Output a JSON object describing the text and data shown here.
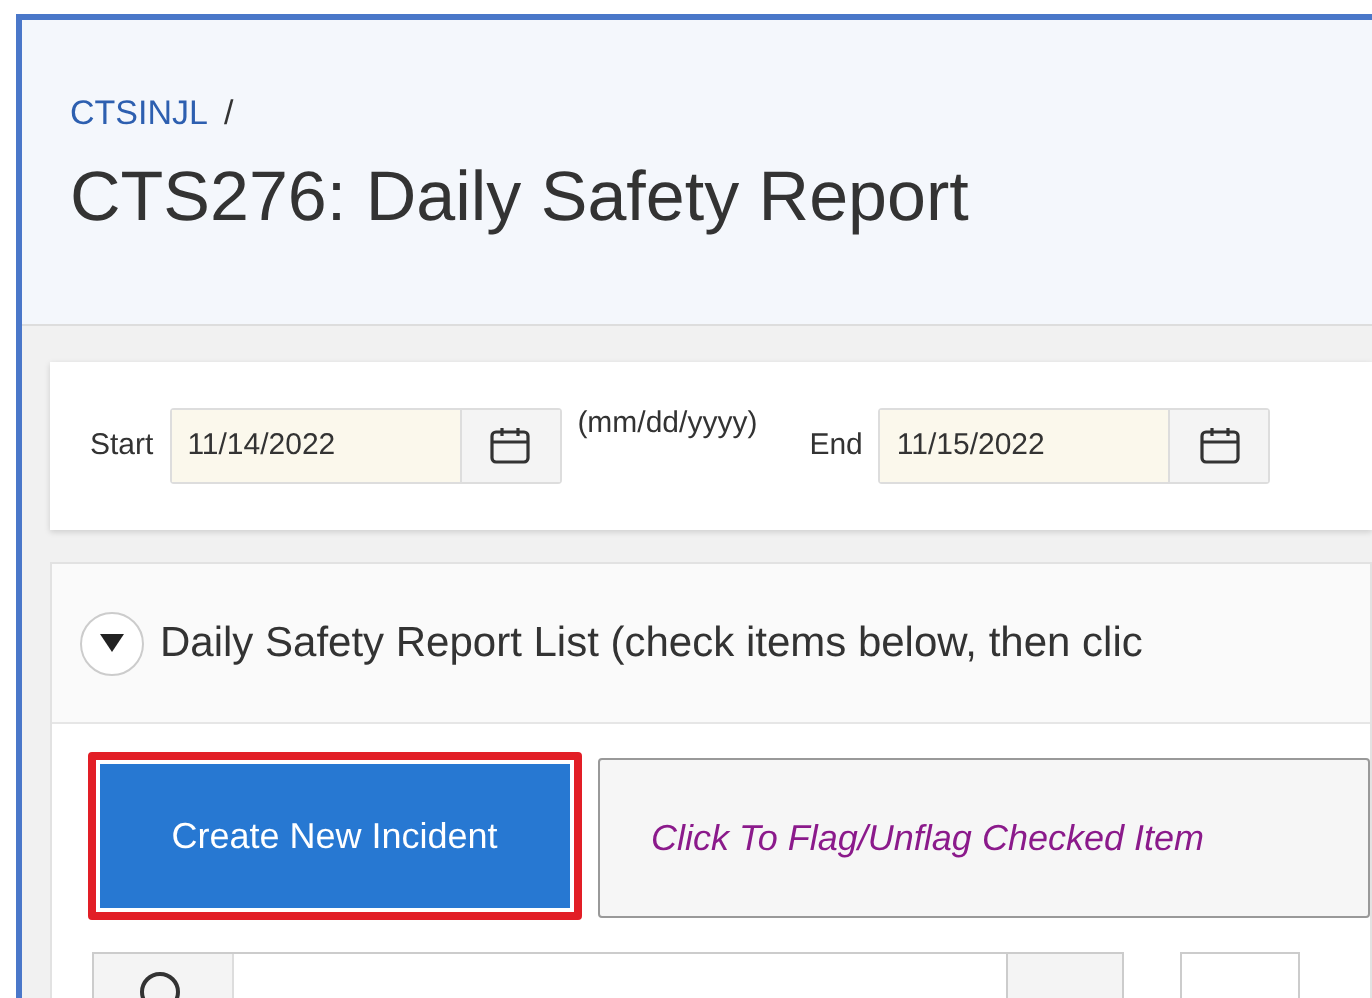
{
  "breadcrumb": {
    "link": "CTSINJL",
    "separator": "/"
  },
  "page_title": "CTS276: Daily Safety Report",
  "date_filters": [
    {
      "label": "Start",
      "value": "11/14/2022",
      "hint": "(mm/dd/yyyy)"
    },
    {
      "label": "End",
      "value": "11/15/2022"
    }
  ],
  "region": {
    "title": "Daily Safety Report List (check items below, then clic",
    "expanded": true
  },
  "buttons": [
    {
      "label": "Create New Incident",
      "kind": "primary",
      "highlighted": true
    },
    {
      "label": "Click To Flag/Unflag Checked Item",
      "kind": "flag",
      "highlighted": false
    }
  ]
}
